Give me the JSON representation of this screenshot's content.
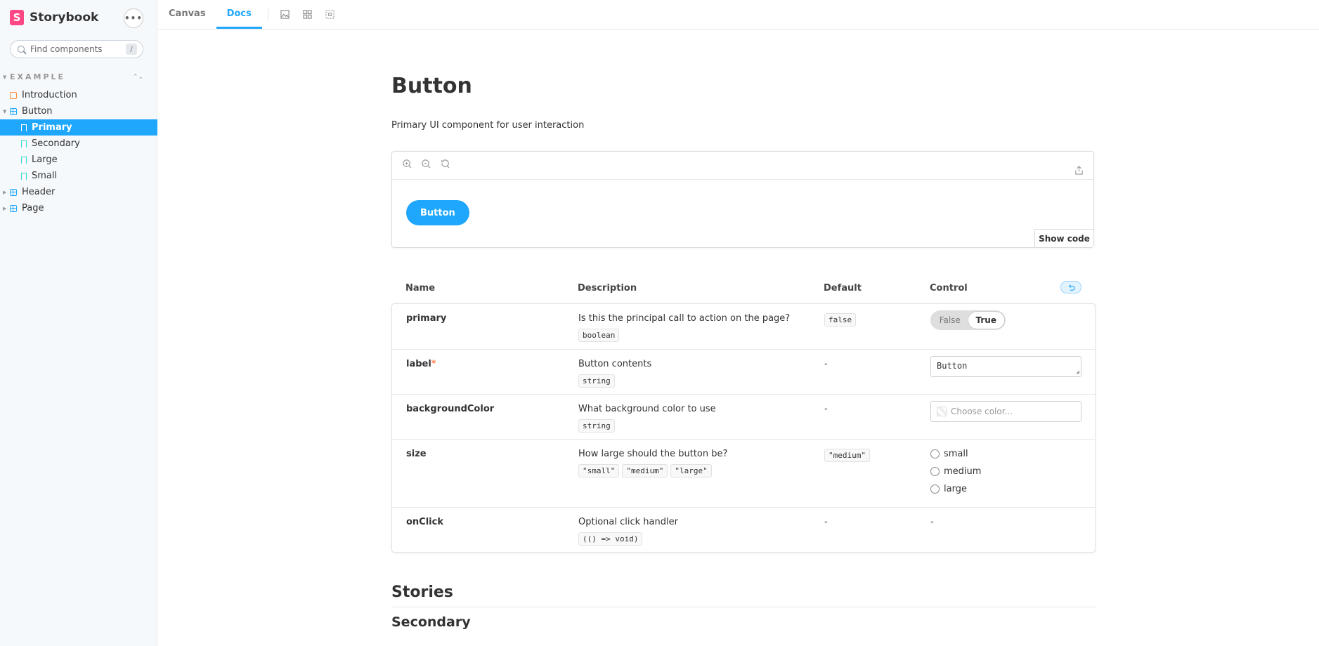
{
  "brand": {
    "name": "Storybook",
    "logo_letter": "S",
    "more": "•••"
  },
  "search": {
    "placeholder": "Find components",
    "shortcut": "/"
  },
  "sidebar": {
    "group": "EXAMPLE",
    "items": [
      {
        "label": "Introduction",
        "type": "doc",
        "level": 0
      },
      {
        "label": "Button",
        "type": "component",
        "level": 0,
        "expanded": true
      },
      {
        "label": "Primary",
        "type": "story",
        "level": 1,
        "selected": true
      },
      {
        "label": "Secondary",
        "type": "story",
        "level": 1
      },
      {
        "label": "Large",
        "type": "story",
        "level": 1
      },
      {
        "label": "Small",
        "type": "story",
        "level": 1
      },
      {
        "label": "Header",
        "type": "component",
        "level": 0
      },
      {
        "label": "Page",
        "type": "component",
        "level": 0
      }
    ]
  },
  "toolbar": {
    "tabs": [
      "Canvas",
      "Docs"
    ],
    "active_tab": "Docs",
    "icons": [
      "image-background-icon",
      "grid-icon",
      "outline-icon"
    ]
  },
  "doc": {
    "title": "Button",
    "subtitle": "Primary UI component for user interaction",
    "preview": {
      "button_label": "Button",
      "show_code": "Show code",
      "zoom_icons": [
        "zoom-in-icon",
        "zoom-out-icon",
        "zoom-reset-icon"
      ]
    },
    "args_headers": {
      "name": "Name",
      "description": "Description",
      "default": "Default",
      "control": "Control"
    },
    "args": {
      "primary": {
        "name": "primary",
        "description": "Is this the principal call to action on the page?",
        "type": "boolean",
        "default": "false",
        "control_options": [
          "False",
          "True"
        ],
        "control_value": "True"
      },
      "label": {
        "name": "label",
        "required_mark": "*",
        "description": "Button contents",
        "type": "string",
        "default": "-",
        "control_value": "Button"
      },
      "backgroundColor": {
        "name": "backgroundColor",
        "description": "What background color to use",
        "type": "string",
        "default": "-",
        "control_placeholder": "Choose color..."
      },
      "size": {
        "name": "size",
        "description": "How large should the button be?",
        "types": [
          "\"small\"",
          "\"medium\"",
          "\"large\""
        ],
        "default": "\"medium\"",
        "options": [
          "small",
          "medium",
          "large"
        ]
      },
      "onClick": {
        "name": "onClick",
        "description": "Optional click handler",
        "type": "(() => void)",
        "default": "-",
        "control": "-"
      }
    },
    "stories_heading": "Stories",
    "story_heading": "Secondary"
  },
  "colors": {
    "accent": "#1ea7fd",
    "brand": "#ff4785",
    "required": "#ff4400"
  }
}
